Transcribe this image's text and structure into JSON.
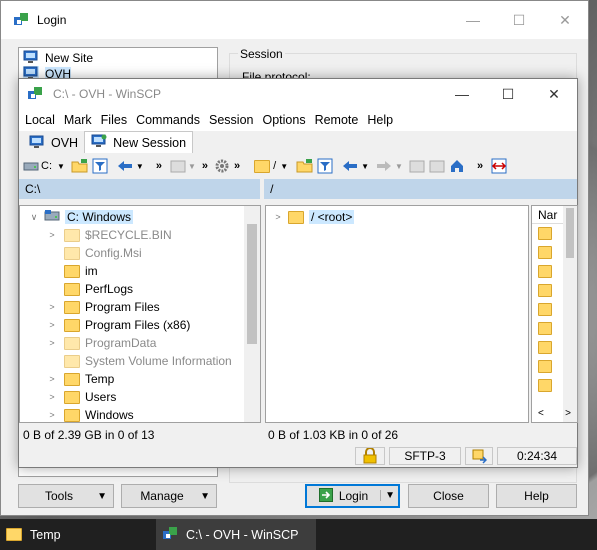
{
  "login": {
    "title": "Login",
    "sites": [
      "New Site",
      "OVH"
    ],
    "session_legend": "Session",
    "file_protocol_label": "File protocol:",
    "buttons": {
      "tools": "Tools",
      "manage": "Manage",
      "login": "Login",
      "close": "Close",
      "help": "Help"
    }
  },
  "winscp": {
    "title": "C:\\ - OVH - WinSCP",
    "menu": [
      "Local",
      "Mark",
      "Files",
      "Commands",
      "Session",
      "Options",
      "Remote",
      "Help"
    ],
    "tabs": [
      "OVH",
      "New Session"
    ],
    "local": {
      "drive": "C:",
      "path": "C:\\",
      "root_label": "C: Windows",
      "tree": [
        {
          "name": "$RECYCLE.BIN",
          "hidden": true,
          "expandable": true
        },
        {
          "name": "Config.Msi",
          "hidden": true,
          "expandable": false
        },
        {
          "name": "im",
          "hidden": false,
          "expandable": false
        },
        {
          "name": "PerfLogs",
          "hidden": false,
          "expandable": false
        },
        {
          "name": "Program Files",
          "hidden": false,
          "expandable": true
        },
        {
          "name": "Program Files (x86)",
          "hidden": false,
          "expandable": true
        },
        {
          "name": "ProgramData",
          "hidden": true,
          "expandable": true
        },
        {
          "name": "System Volume Information",
          "hidden": true,
          "expandable": false
        },
        {
          "name": "Temp",
          "hidden": false,
          "expandable": true
        },
        {
          "name": "Users",
          "hidden": false,
          "expandable": true
        },
        {
          "name": "Windows",
          "hidden": false,
          "expandable": true
        }
      ],
      "status": "0 B of 2.39 GB in 0 of 13"
    },
    "remote": {
      "path_combo": "/",
      "path": "/",
      "root_label": "/ <root>",
      "column_header": "Nar",
      "status": "0 B of 1.03 KB in 0 of 26"
    },
    "statusbar": {
      "protocol": "SFTP-3",
      "time": "0:24:34"
    }
  },
  "taskbar": {
    "items": [
      "Temp",
      "C:\\ - OVH - WinSCP"
    ]
  }
}
